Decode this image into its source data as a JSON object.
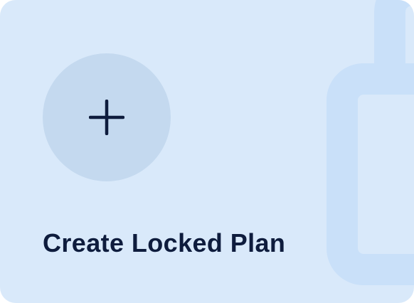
{
  "card": {
    "title": "Create Locked Plan",
    "background_color": "#d9e9fa",
    "accent_circle_color": "#c4d9ef",
    "decoration_color": "#c9e0f9",
    "text_color": "#0e1c3d"
  },
  "icons": {
    "action_icon": "plus-icon",
    "background_icon": "lock-icon"
  }
}
